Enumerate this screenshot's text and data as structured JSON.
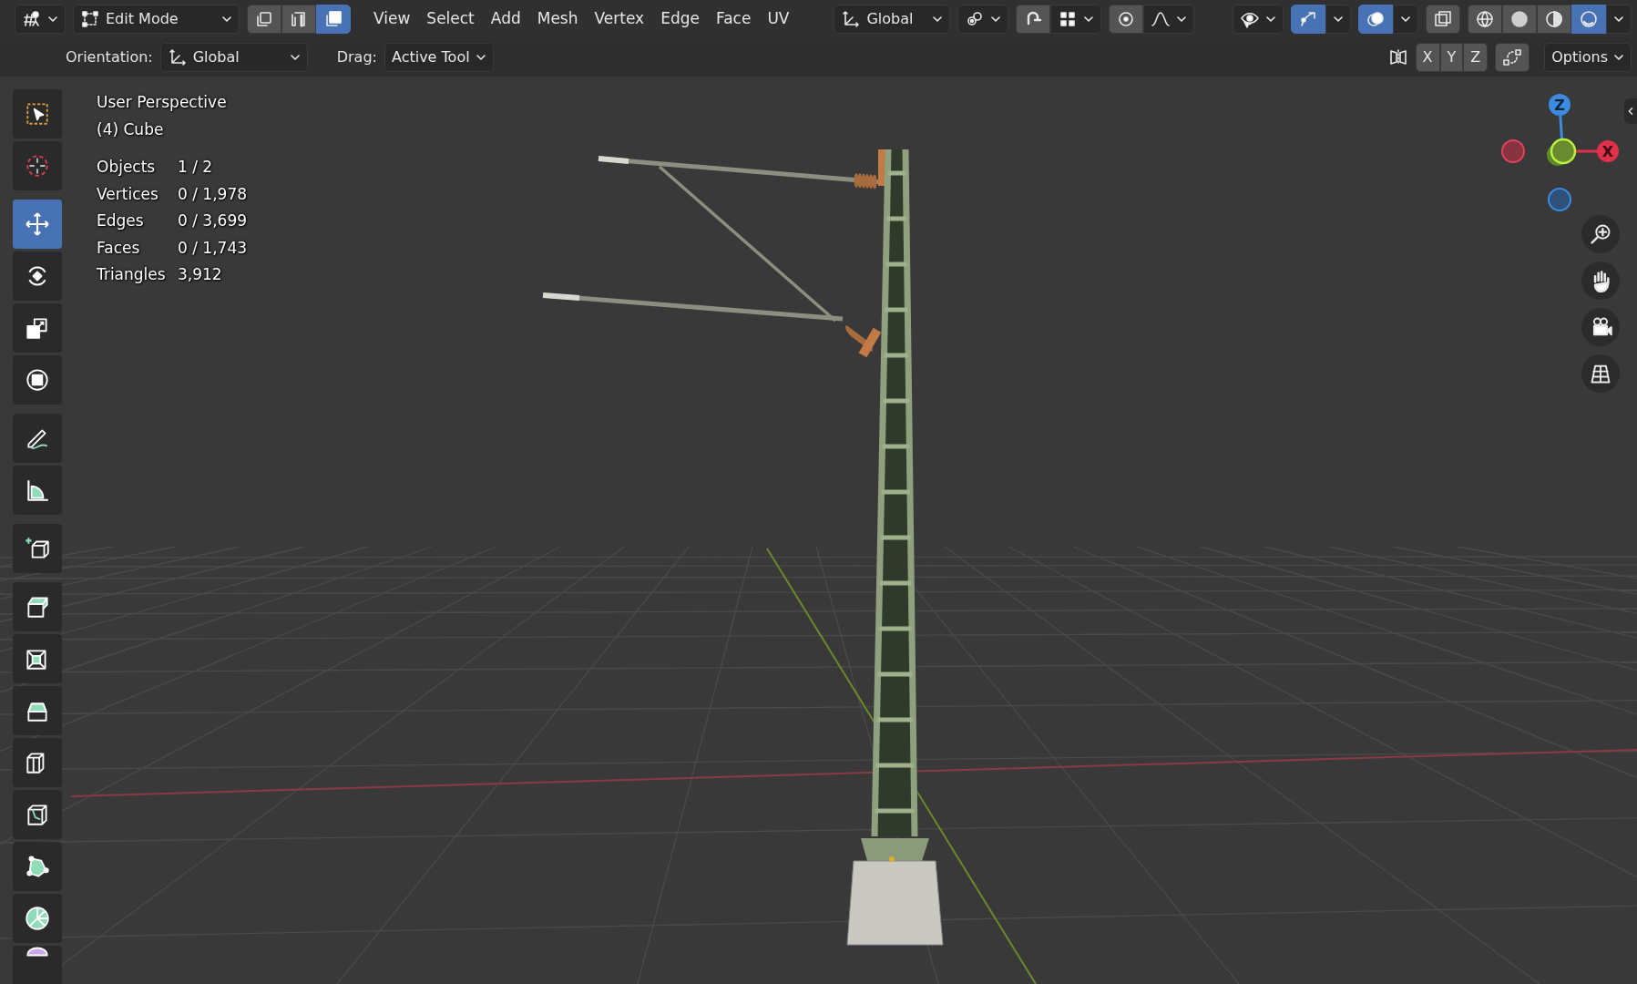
{
  "header": {
    "mode": "Edit Mode",
    "select_modes": [
      {
        "selected": false
      },
      {
        "selected": false
      },
      {
        "selected": true
      }
    ],
    "menus": [
      "View",
      "Select",
      "Add",
      "Mesh",
      "Vertex",
      "Edge",
      "Face",
      "UV"
    ],
    "transform_orientation": "Global",
    "snapping": {
      "on": false
    },
    "proportional_editing": {
      "on": false
    },
    "gizmos": {
      "on": true
    },
    "overlays": {
      "on": true
    },
    "xray": {
      "on": false
    },
    "shading": [
      {
        "selected": false
      },
      {
        "selected": false
      },
      {
        "selected": false
      },
      {
        "selected": true
      }
    ]
  },
  "tool_settings": {
    "orientation_label": "Orientation:",
    "orientation": "Global",
    "drag_label": "Drag:",
    "drag": "Active Tool",
    "mirror_axes": [
      {
        "label": "X",
        "selected": false
      },
      {
        "label": "Y",
        "selected": false
      },
      {
        "label": "Z",
        "selected": false
      }
    ],
    "options": "Options"
  },
  "toolbar": {
    "tools": [
      {
        "selected": false
      },
      {
        "selected": false
      },
      {
        "selected": true
      },
      {
        "selected": false
      },
      {
        "selected": false
      },
      {
        "selected": false
      },
      {
        "selected": false
      },
      {
        "selected": false
      },
      {
        "selected": false
      },
      {
        "selected": false
      },
      {
        "selected": false
      },
      {
        "selected": false
      },
      {
        "selected": false
      },
      {
        "selected": false
      },
      {
        "selected": false
      },
      {
        "selected": false
      },
      {
        "selected": false
      }
    ]
  },
  "viewport": {
    "view_name": "User Perspective",
    "object_name": "(4) Cube",
    "stats": [
      {
        "label": "Objects",
        "value": "1 / 2"
      },
      {
        "label": "Vertices",
        "value": "0 / 1,978"
      },
      {
        "label": "Edges",
        "value": "0 / 3,699"
      },
      {
        "label": "Faces",
        "value": "0 / 1,743"
      },
      {
        "label": "Triangles",
        "value": "3,912"
      }
    ],
    "gizmo": {
      "z_label": "Z",
      "x_label": "X"
    }
  }
}
